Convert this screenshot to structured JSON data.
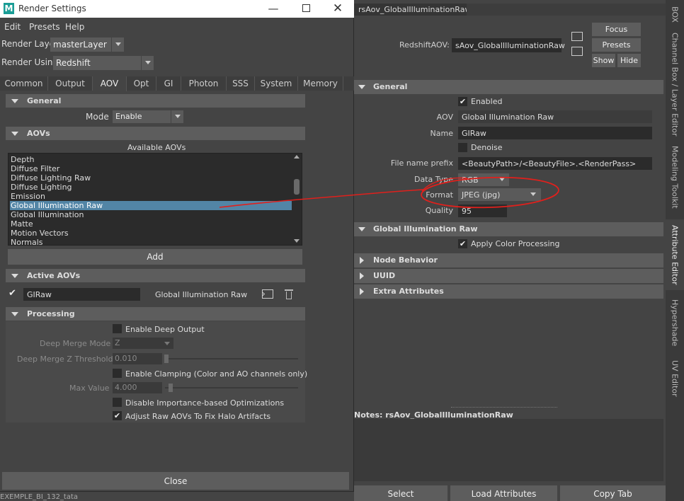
{
  "attribute_editor": {
    "tab_label": "rsAov_GlobalIlluminationRaw",
    "node_label": "RedshiftAOV:",
    "node_name": "sAov_GlobalIlluminationRaw",
    "buttons": {
      "focus": "Focus",
      "presets": "Presets",
      "show": "Show",
      "hide": "Hide"
    },
    "general_section": "General",
    "enabled_label": "Enabled",
    "enabled_checked": true,
    "aov_label": "AOV",
    "aov_value": "Global Illumination Raw",
    "name_label": "Name",
    "name_value": "GIRaw",
    "denoise_label": "Denoise",
    "file_prefix_label": "File name prefix",
    "file_prefix_value": "<BeautyPath>/<BeautyFile>.<RenderPass>",
    "data_type_label": "Data Type",
    "data_type_value": "RGB",
    "format_label": "Format",
    "format_value": "JPEG (jpg)",
    "quality_label": "Quality",
    "quality_value": "95",
    "gi_raw_section": "Global Illumination Raw",
    "apply_color_label": "Apply Color Processing",
    "node_behavior_section": "Node Behavior",
    "uuid_section": "UUID",
    "extra_attributes_section": "Extra Attributes",
    "notes_label": "Notes:  rsAov_GlobalIlluminationRaw",
    "bottom_buttons": {
      "select": "Select",
      "load": "Load Attributes",
      "copy": "Copy Tab"
    },
    "corner_text": "EXEMPLE_BI_132_tata"
  },
  "side_tabs": {
    "box": "BOX",
    "channel_box": "Channel Box / Layer Editor",
    "modeling_toolkit": "Modeling Toolkit",
    "attribute_editor": "Attribute Editor",
    "hypershade": "Hypershade",
    "uv_editor": "UV Editor"
  },
  "render_settings": {
    "title": "Render Settings",
    "app_icon": "M",
    "menu": {
      "edit": "Edit",
      "presets": "Presets",
      "help": "Help"
    },
    "render_layer_label": "Render Layer",
    "render_layer_value": "masterLayer",
    "render_using_label": "Render Using",
    "render_using_value": "Redshift",
    "tabs": [
      "Common",
      "Output",
      "AOV",
      "Opt",
      "GI",
      "Photon",
      "SSS",
      "System",
      "Memory"
    ],
    "active_tab": "AOV",
    "general_section": "General",
    "mode_label": "Mode",
    "mode_value": "Enable",
    "aovs_section": "AOVs",
    "available_label": "Available AOVs",
    "available_aovs": [
      "Depth",
      "Diffuse Filter",
      "Diffuse Lighting Raw",
      "Diffuse Lighting",
      "Emission",
      "Global Illumination Raw",
      "Global Illumination",
      "Matte",
      "Motion Vectors",
      "Normals"
    ],
    "selected_aov": "Global Illumination Raw",
    "add_button": "Add",
    "active_aovs_section": "Active AOVs",
    "active_aov_name": "GIRaw",
    "active_aov_type": "Global Illumination Raw",
    "processing_section": "Processing",
    "enable_deep_output": "Enable Deep Output",
    "deep_merge_mode_label": "Deep Merge Mode",
    "deep_merge_mode_value": "Z",
    "deep_merge_z_label": "Deep Merge Z Threshold",
    "deep_merge_z_value": "0.010",
    "enable_clamping": "Enable Clamping (Color and AO channels only)",
    "max_value_label": "Max Value",
    "max_value_value": "4.000",
    "disable_importance": "Disable Importance-based Optimizations",
    "adjust_raw": "Adjust Raw AOVs To Fix Halo Artifacts",
    "adjust_raw_checked": true,
    "close_button": "Close"
  },
  "colors": {
    "background": "#444444",
    "field": "#2b2b2b",
    "section_header": "#5d5d5d",
    "selection": "#5285a6",
    "annotation": "#e0201c"
  }
}
